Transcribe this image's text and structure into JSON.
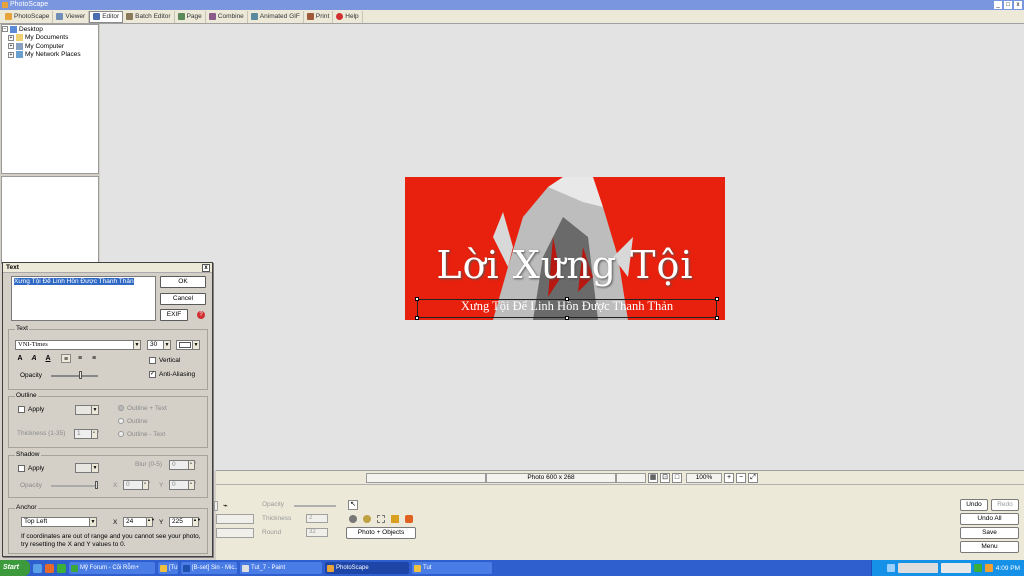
{
  "window": {
    "title": "PhotoScape",
    "controls": [
      "_",
      "□",
      "x"
    ]
  },
  "tabs": [
    {
      "label": "PhotoScape",
      "color": "#e8a43a"
    },
    {
      "label": "Viewer",
      "color": "#6f8fb8"
    },
    {
      "label": "Editor",
      "color": "#4a6fb0"
    },
    {
      "label": "Batch Editor",
      "color": "#8a7a5a"
    },
    {
      "label": "Page",
      "color": "#5a8a5a"
    },
    {
      "label": "Combine",
      "color": "#8a5a8a"
    },
    {
      "label": "Animated GIF",
      "color": "#5a8aa0"
    },
    {
      "label": "Print",
      "color": "#a05a3a"
    },
    {
      "label": "Help",
      "color": "#d03030"
    }
  ],
  "active_tab": "Editor",
  "tree": {
    "root": "Desktop",
    "items": [
      "My Documents",
      "My Computer",
      "My Network Places"
    ]
  },
  "photo": {
    "title": "Lời Xưng Tội",
    "subtitle": "Xưng Tội Để Linh Hồn Được Thanh Thản",
    "bg_color": "#e8200e"
  },
  "status": {
    "photo_info": "Photo 600 x 268",
    "zoom": "100%"
  },
  "toolpanel": {
    "opacity_label": "Opacity",
    "thickness_label": "Thickness",
    "thickness_value": "2",
    "round_label": "Round",
    "round_value": "32",
    "photo_objects_button": "Photo + Objects",
    "undo": "Undo",
    "redo": "Redo",
    "undo_all": "Undo All",
    "save": "Save",
    "menu": "Menu"
  },
  "dialog": {
    "title": "Text",
    "text_value": "Xưng Tội Để Linh Hồn Được Thanh Thản",
    "ok": "OK",
    "cancel": "Cancel",
    "exif": "EXIF",
    "text_group": "Text",
    "font": "VNI-Times",
    "size": "30",
    "vertical": "Vertical",
    "anti_aliasing": "Anti-Aliasing",
    "opacity_label": "Opacity",
    "outline_group": "Outline",
    "apply": "Apply",
    "outline_text": "Outline + Text",
    "outline": "Outline",
    "outline_minus_text": "Outline - Text",
    "thickness_label": "Thickness (1-35)",
    "thickness_value": "1",
    "shadow_group": "Shadow",
    "shadow_apply": "Apply",
    "blur_label": "Blur (0-5)",
    "blur_value": "0",
    "shadow_opacity": "Opacity",
    "shadow_x_label": "X",
    "shadow_x": "0",
    "shadow_y_label": "Y",
    "shadow_y": "0",
    "anchor_group": "Anchor",
    "anchor_value": "Top Left",
    "x_label": "X",
    "x_value": "24",
    "y_label": "Y",
    "y_value": "225",
    "note": "If coordinates are out of range and you cannot see your photo, try resetting the X and Y values to 0."
  },
  "taskbar": {
    "start": "Start",
    "tasks": [
      {
        "label": "Mỹ Forum - Cõi Rỗm+",
        "color": "#3aa83a"
      },
      {
        "label": "[Tut ...]",
        "color": "#f0c040"
      },
      {
        "label": "[B-set] Sin - Mic...",
        "color": "#2050b0"
      },
      {
        "label": "Tut_7 - Paint",
        "color": "#e0e0e0"
      },
      {
        "label": "PhotoScape",
        "color": "#e8a43a"
      },
      {
        "label": "Tut",
        "color": "#f0c040"
      }
    ],
    "time": "4:09 PM"
  }
}
